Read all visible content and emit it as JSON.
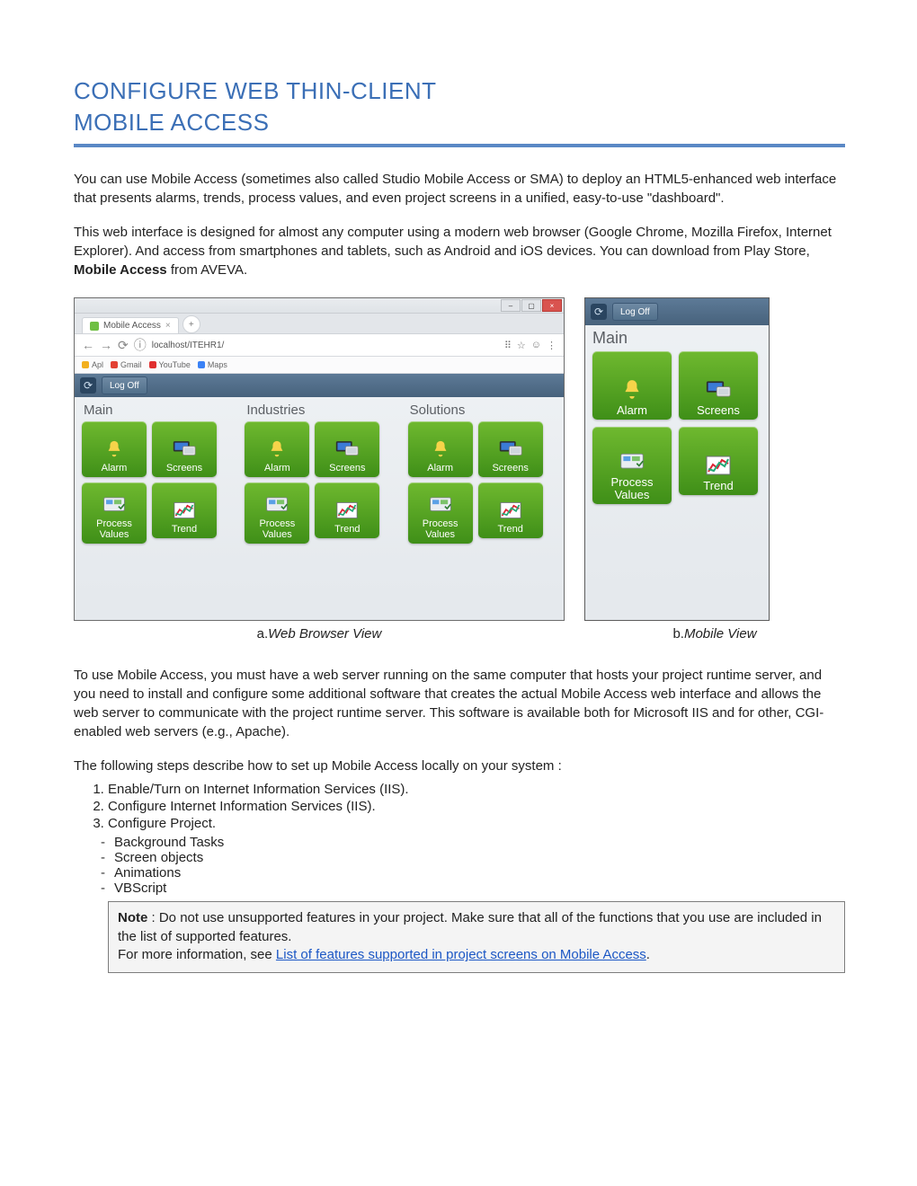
{
  "heading": {
    "line1": "CONFIGURE WEB THIN-CLIENT",
    "line2": "MOBILE ACCESS"
  },
  "para1_a": "You can use Mobile Access (sometimes also called Studio Mobile Access or SMA) to deploy an HTML5-enhanced web interface that presents alarms, trends, process values, and even project screens in a unified, easy-to-use \"dashboard\".",
  "para2_a": "This web interface is designed for almost any computer using a modern web browser (Google Chrome, Mozilla Firefox, Internet Explorer). And access from smartphones and tablets, such as Android and iOS devices. You can download from Play Store, ",
  "para2_bold": "Mobile Access",
  "para2_b": " from AVEVA.",
  "browser": {
    "tab_title": "Mobile Access",
    "url": "localhost/ITEHR1/",
    "bookmarks": [
      "Apl",
      "Gmail",
      "YouTube",
      "Maps"
    ],
    "logoff": "Log Off",
    "columns": [
      "Main",
      "Industries",
      "Solutions"
    ],
    "tiles": {
      "alarm": "Alarm",
      "screens": "Screens",
      "pv": "Process\nValues",
      "trend": "Trend"
    }
  },
  "mobile": {
    "logoff": "Log Off",
    "header": "Main",
    "tiles": {
      "alarm": "Alarm",
      "screens": "Screens",
      "pv": "Process\nValues",
      "trend": "Trend"
    }
  },
  "caption_a_prefix": "a.",
  "caption_a": "Web Browser View",
  "caption_b_prefix": "b.",
  "caption_b": "Mobile View",
  "para3": "To use Mobile Access, you must have a web server running on the same computer that hosts your project runtime server, and you need to install and configure some additional software that creates the actual Mobile Access web interface and allows the web server to communicate with the project runtime server. This software is available both for Microsoft IIS and for other, CGI-enabled web servers (e.g., Apache).",
  "para4": "The following steps describe how to set up Mobile Access locally on your system :",
  "steps": [
    "Enable/Turn on Internet Information Services (IIS).",
    "Configure Internet Information Services (IIS).",
    "Configure Project."
  ],
  "substeps": [
    "Background Tasks",
    "Screen objects",
    "Animations",
    "VBScript"
  ],
  "note": {
    "bold": "Note",
    "text1": " : Do not use unsupported features in your project. Make sure that all of the functions that you use are included in the list of supported features.",
    "text2": "For more information, see ",
    "link": "List of features supported in project screens on Mobile Access",
    "text3": "."
  }
}
